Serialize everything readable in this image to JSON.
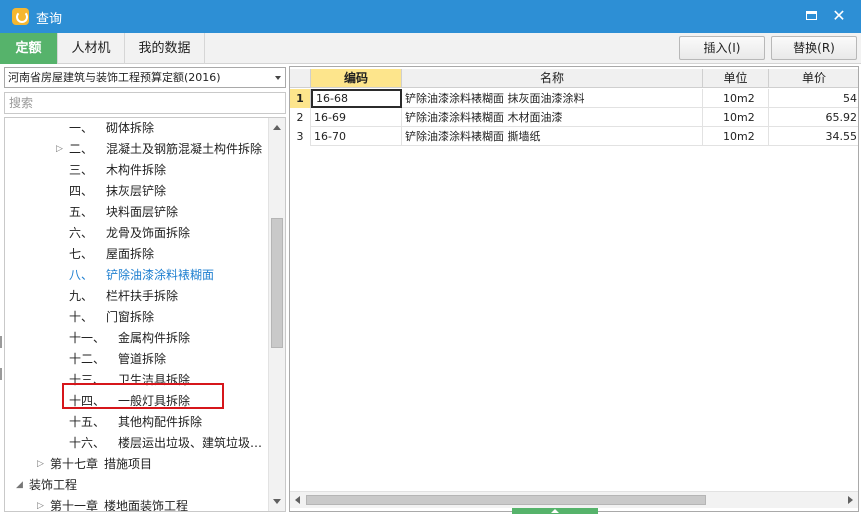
{
  "window": {
    "title": "查询",
    "maximize_label": "maximize",
    "close_glyph": "✕"
  },
  "tabs": [
    {
      "label": "定额",
      "active": true
    },
    {
      "label": "人材机",
      "active": false
    },
    {
      "label": "我的数据",
      "active": false
    }
  ],
  "toolbar": {
    "insert_label": "插入(I)",
    "replace_label": "替换(R)"
  },
  "left": {
    "library": "河南省房屋建筑与装饰工程预算定额(2016)",
    "search_placeholder": "搜索",
    "tree": [
      {
        "num": "一、",
        "label": "砌体拆除",
        "level": 2
      },
      {
        "num": "二、",
        "label": "混凝土及钢筋混凝土构件拆除",
        "level": 2,
        "toggle": "▷"
      },
      {
        "num": "三、",
        "label": "木构件拆除",
        "level": 2
      },
      {
        "num": "四、",
        "label": "抹灰层铲除",
        "level": 2
      },
      {
        "num": "五、",
        "label": "块料面层铲除",
        "level": 2
      },
      {
        "num": "六、",
        "label": "龙骨及饰面拆除",
        "level": 2
      },
      {
        "num": "七、",
        "label": "屋面拆除",
        "level": 2
      },
      {
        "num": "八、",
        "label": "铲除油漆涂料裱糊面",
        "level": 2,
        "selected": true
      },
      {
        "num": "九、",
        "label": "栏杆扶手拆除",
        "level": 2
      },
      {
        "num": "十、",
        "label": "门窗拆除",
        "level": 2
      },
      {
        "num": "十一、",
        "label": "金属构件拆除",
        "level": 2
      },
      {
        "num": "十二、",
        "label": "管道拆除",
        "level": 2
      },
      {
        "num": "十三、",
        "label": "卫生洁具拆除",
        "level": 2
      },
      {
        "num": "十四、",
        "label": "一般灯具拆除",
        "level": 2
      },
      {
        "num": "十五、",
        "label": "其他构配件拆除",
        "level": 2
      },
      {
        "num": "十六、",
        "label": "楼层运出垃圾、建筑垃圾…",
        "level": 2
      },
      {
        "num": "第十七章",
        "label": "措施项目",
        "level": 1,
        "toggle": "▷"
      },
      {
        "num": "",
        "label": "装饰工程",
        "level": 0,
        "toggle": "◢"
      },
      {
        "num": "第十一章",
        "label": "楼地面装饰工程",
        "level": 1,
        "toggle": "▷"
      }
    ]
  },
  "grid": {
    "columns": [
      "编码",
      "名称",
      "单位",
      "单价"
    ],
    "rows": [
      {
        "index": "1",
        "code": "16-68",
        "name": "铲除油漆涂料裱糊面 抹灰面油漆涂料",
        "unit": "10m2",
        "price": "54"
      },
      {
        "index": "2",
        "code": "16-69",
        "name": "铲除油漆涂料裱糊面 木材面油漆",
        "unit": "10m2",
        "price": "65.92"
      },
      {
        "index": "3",
        "code": "16-70",
        "name": "铲除油漆涂料裱糊面 撕墙纸",
        "unit": "10m2",
        "price": "34.55"
      }
    ]
  },
  "colors": {
    "titlebar": "#2d8fd5",
    "active_tab": "#56b36b",
    "header_highlight": "#fde58c",
    "selection_box": "#d6161b",
    "selected_text": "#1e7fd0"
  }
}
